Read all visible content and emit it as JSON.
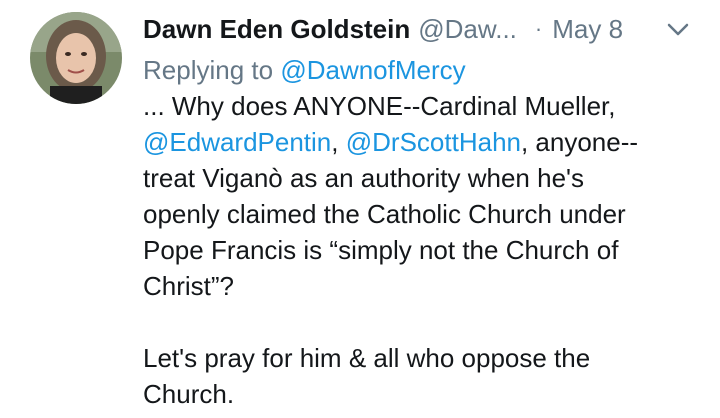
{
  "author": {
    "display_name": "Dawn Eden Goldstein",
    "handle": "@Daw...",
    "separator": "·",
    "date": "May 8"
  },
  "reply": {
    "prefix": "Replying to",
    "to": "@DawnofMercy"
  },
  "body": {
    "line1": "... Why does ANYONE--Cardinal Mueller,",
    "mention1": "@EdwardPentin",
    "comma": ",",
    "mention2": "@DrScottHahn",
    "line2_rest": ", anyone--",
    "line3": "treat Viganò as an authority when he's",
    "line4": "openly claimed the Catholic Church under",
    "line5": "Pope Francis is “simply not the Church of",
    "line6": "Christ”?",
    "line7": "Let's pray for him & all who oppose the",
    "line8": "Church."
  },
  "icons": {
    "menu": "chevron-down-icon"
  },
  "colors": {
    "link": "#1b95e0",
    "muted": "#657786",
    "text": "#14171a"
  }
}
